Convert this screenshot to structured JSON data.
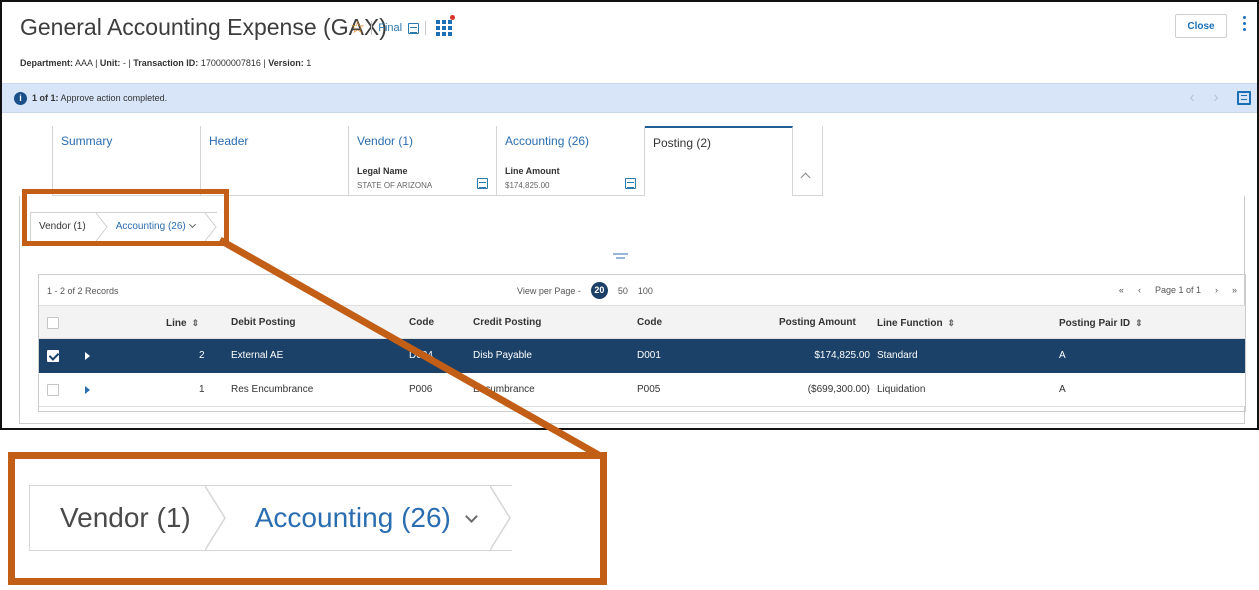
{
  "window": {
    "title": "General Accounting Expense (GAX)",
    "status_label": "Final",
    "close_label": "Close",
    "meta": {
      "department_label": "Department:",
      "department_value": "AAA",
      "unit_label": "Unit:",
      "unit_value": "-",
      "txn_label": "Transaction ID:",
      "txn_value": "170000007816",
      "version_label": "Version:",
      "version_value": "1"
    }
  },
  "message_bar": {
    "count": "1 of 1:",
    "text": "Approve action completed."
  },
  "tabs": [
    {
      "label": "Summary"
    },
    {
      "label": "Header"
    },
    {
      "label": "Vendor (1)",
      "sub_label": "Legal Name",
      "sub_value": "STATE OF ARIZONA"
    },
    {
      "label": "Accounting (26)",
      "sub_label": "Line Amount",
      "sub_value": "$174,825.00"
    },
    {
      "label": "Posting (2)"
    }
  ],
  "breadcrumb": {
    "items": [
      "Vendor (1)",
      "Accounting (26)"
    ]
  },
  "grid": {
    "records": "1 - 2 of 2 Records",
    "view_per_page_label": "View per Page -",
    "page_sizes": [
      "20",
      "50",
      "100"
    ],
    "selected_page_size": "20",
    "page_info": "Page 1 of 1",
    "columns": [
      "Line",
      "Debit Posting",
      "Code",
      "Credit Posting",
      "Code",
      "Posting Amount",
      "Line Function",
      "Posting Pair ID"
    ],
    "rows": [
      {
        "line": "2",
        "debit_posting": "External AE",
        "debit_code": "D004",
        "credit_posting": "Disb Payable",
        "credit_code": "D001",
        "amount": "$174,825.00",
        "line_function": "Standard",
        "pair_id": "A",
        "selected": true
      },
      {
        "line": "1",
        "debit_posting": "Res Encumbrance",
        "debit_code": "P006",
        "credit_posting": "Encumbrance",
        "credit_code": "P005",
        "amount": "($699,300.00)",
        "line_function": "Liquidation",
        "pair_id": "A",
        "selected": false
      }
    ]
  },
  "zoom_callout": {
    "items": [
      "Vendor (1)",
      "Accounting (26)"
    ]
  },
  "colors": {
    "accent": "#1b6fb5",
    "selected_row": "#1b4168",
    "callout": "#c25e16",
    "message_bar": "#d8e4f8"
  }
}
